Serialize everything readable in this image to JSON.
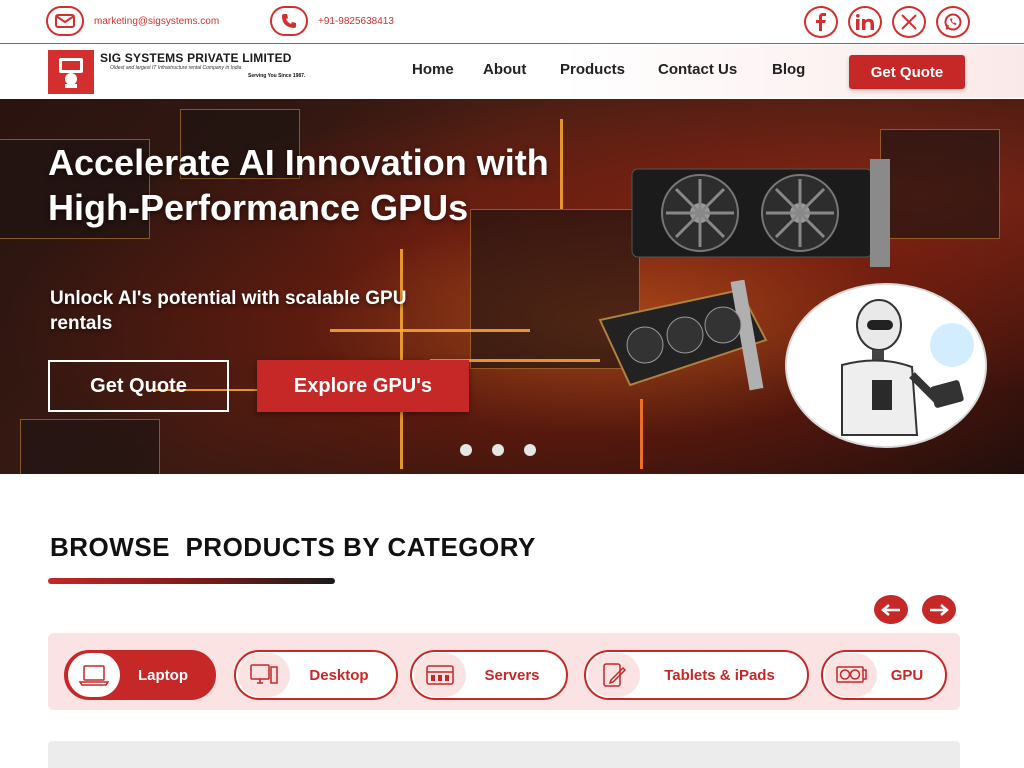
{
  "topbar": {
    "email": "marketing@sigsystems.com",
    "phone": "+91-9825638413",
    "icons": {
      "email": "mail-icon",
      "phone": "phone-icon"
    },
    "social": [
      "facebook-icon",
      "linkedin-icon",
      "x-icon",
      "whatsapp-icon"
    ]
  },
  "header": {
    "company": "SIG SYSTEMS PRIVATE LIMITED",
    "tagline": "Oldest and largest IT Infrastructure rental Company in India",
    "since": "Serving You Since 1987.",
    "nav": [
      "Home",
      "About",
      "Products",
      "Contact Us",
      "Blog"
    ],
    "cta": "Get Quote"
  },
  "hero": {
    "title": "Accelerate AI Innovation with High-Performance GPUs",
    "subtitle": "Unlock AI's potential with scalable GPU rentals",
    "primary_button": "Get Quote",
    "secondary_button": "Explore GPU's",
    "slides": 3
  },
  "categories": {
    "heading": "BROWSE  PRODUCTS BY CATEGORY",
    "items": [
      {
        "label": "Laptop",
        "icon": "laptop-icon",
        "active": true
      },
      {
        "label": "Desktop",
        "icon": "desktop-icon",
        "active": false
      },
      {
        "label": "Servers",
        "icon": "server-icon",
        "active": false
      },
      {
        "label": "Tablets & iPads",
        "icon": "tablet-icon",
        "active": false
      },
      {
        "label": "GPU",
        "icon": "gpu-icon",
        "active": false
      }
    ]
  },
  "colors": {
    "brand_red": "#c62828",
    "strip_pink": "#fbe3e3"
  }
}
